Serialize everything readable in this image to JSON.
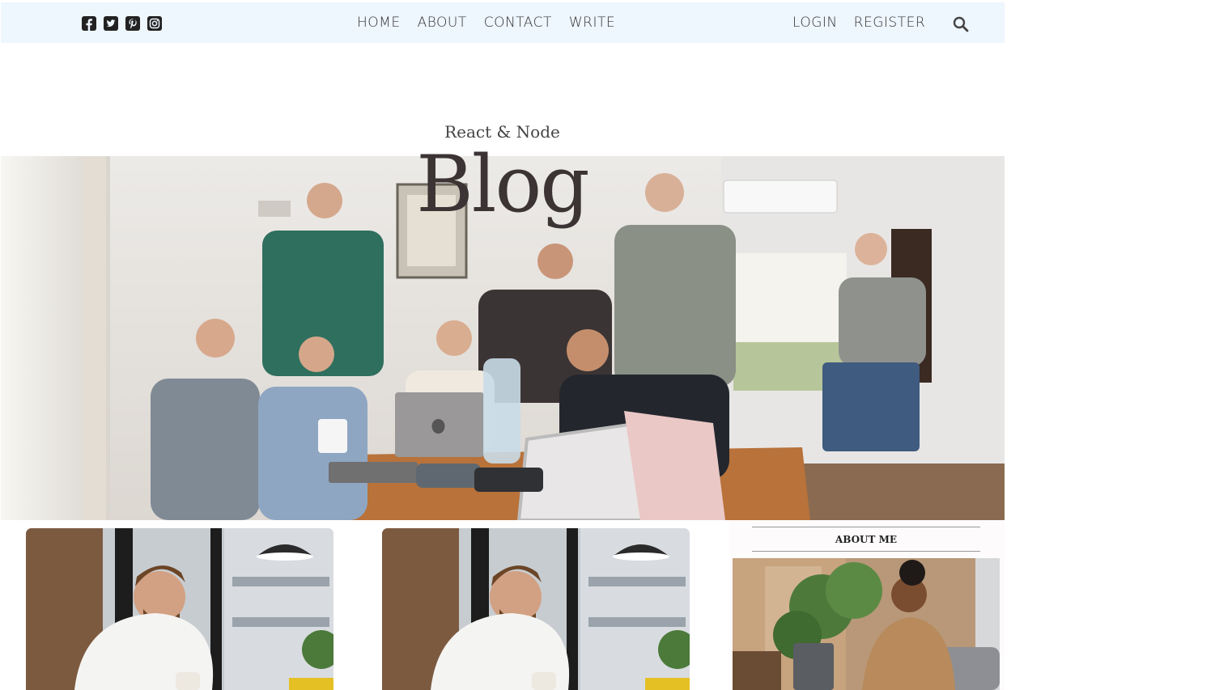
{
  "topbar": {
    "social_icons": [
      "facebook-square-icon",
      "twitter-square-icon",
      "pinterest-square-icon",
      "instagram-square-icon"
    ],
    "nav_center": [
      "HOME",
      "ABOUT",
      "CONTACT",
      "WRITE"
    ],
    "nav_right": [
      "LOGIN",
      "REGISTER"
    ],
    "search_icon": "search-icon"
  },
  "header": {
    "title_small": "React & Node",
    "title_large": "Blog"
  },
  "hero": {
    "image": "team-around-laptops-photo"
  },
  "posts": [
    {
      "image": "man-laughing-with-laptop-photo"
    },
    {
      "image": "man-laughing-with-laptop-photo"
    }
  ],
  "sidebar": {
    "title": "ABOUT ME",
    "image": "woman-working-on-laptop-photo"
  },
  "colors": {
    "topbar_bg": "#eef6fe",
    "text": "#333333",
    "header": "#3c3434"
  }
}
